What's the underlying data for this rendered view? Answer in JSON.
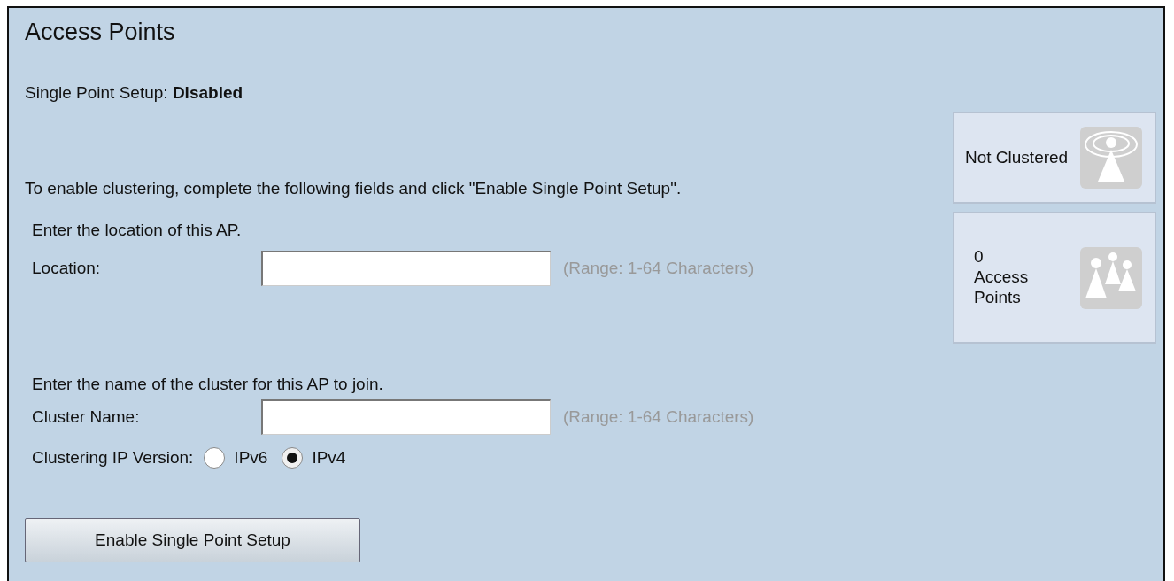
{
  "title": "Access Points",
  "status": "Single Point Setup: **Disabled**",
  "instruction": "To enable clustering, complete the following fields and click \"Enable Single Point Setup\".",
  "location": {
    "prompt": "Enter the location of this AP.",
    "label": "Location:",
    "hint": "(Range: 1-64 Characters)"
  },
  "cluster": {
    "prompt": "Enter the name of the cluster for this AP to join.",
    "label": "Cluster Name:",
    "hint": "(Range: 1-64 Characters)"
  },
  "ip_version": {
    "label": "Clustering IP Version:",
    "options": [
      {
        "label": "IPv6",
        "selected": false
      },
      {
        "label": "IPv4",
        "selected": true
      }
    ]
  },
  "button": "Enable Single Point Setup",
  "cards": [
    {
      "kind": "status",
      "text": "Not Clustered"
    },
    {
      "kind": "count",
      "text": "0 Access Points"
    }
  ]
}
